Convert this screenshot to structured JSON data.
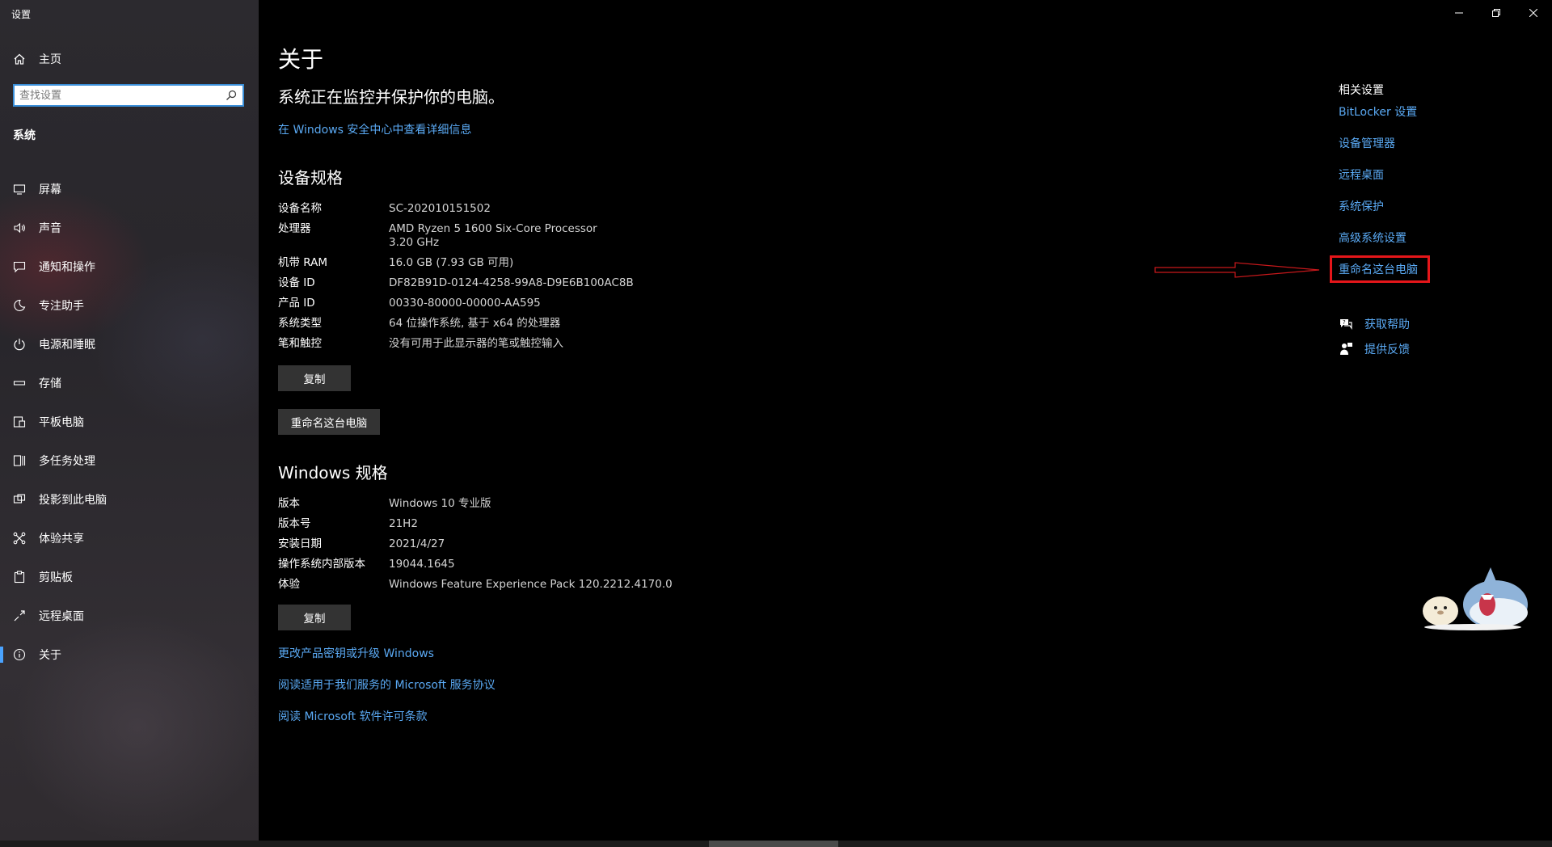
{
  "app": {
    "title": "设置"
  },
  "sidebar": {
    "home_label": "主页",
    "search_placeholder": "查找设置",
    "section_label": "系统",
    "items": [
      {
        "label": "屏幕",
        "icon": "monitor-icon"
      },
      {
        "label": "声音",
        "icon": "speaker-icon"
      },
      {
        "label": "通知和操作",
        "icon": "message-icon"
      },
      {
        "label": "专注助手",
        "icon": "moon-icon"
      },
      {
        "label": "电源和睡眠",
        "icon": "power-icon"
      },
      {
        "label": "存储",
        "icon": "storage-icon"
      },
      {
        "label": "平板电脑",
        "icon": "tablet-icon"
      },
      {
        "label": "多任务处理",
        "icon": "multitask-icon"
      },
      {
        "label": "投影到此电脑",
        "icon": "project-icon"
      },
      {
        "label": "体验共享",
        "icon": "share-icon"
      },
      {
        "label": "剪贴板",
        "icon": "clipboard-icon"
      },
      {
        "label": "远程桌面",
        "icon": "remote-icon"
      },
      {
        "label": "关于",
        "icon": "info-icon",
        "selected": true
      }
    ]
  },
  "main": {
    "title": "关于",
    "status": "系统正在监控并保护你的电脑。",
    "security_link": "在 Windows 安全中心中查看详细信息",
    "device_heading": "设备规格",
    "device_specs": [
      {
        "k": "设备名称",
        "v": "SC-202010151502"
      },
      {
        "k": "处理器",
        "v": "AMD Ryzen 5 1600 Six-Core Processor\n3.20 GHz"
      },
      {
        "k": "机带 RAM",
        "v": "16.0 GB (7.93 GB 可用)"
      },
      {
        "k": "设备 ID",
        "v": "DF82B91D-0124-4258-99A8-D9E6B100AC8B"
      },
      {
        "k": "产品 ID",
        "v": "00330-80000-00000-AA595"
      },
      {
        "k": "系统类型",
        "v": "64 位操作系统, 基于 x64 的处理器"
      },
      {
        "k": "笔和触控",
        "v": "没有可用于此显示器的笔或触控输入"
      }
    ],
    "copy_button": "复制",
    "rename_button": "重命名这台电脑",
    "windows_heading": "Windows 规格",
    "windows_specs": [
      {
        "k": "版本",
        "v": "Windows 10 专业版"
      },
      {
        "k": "版本号",
        "v": "21H2"
      },
      {
        "k": "安装日期",
        "v": "2021/4/27"
      },
      {
        "k": "操作系统内部版本",
        "v": "19044.1645"
      },
      {
        "k": "体验",
        "v": "Windows Feature Experience Pack 120.2212.4170.0"
      }
    ],
    "copy_button_2": "复制",
    "links": [
      "更改产品密钥或升级 Windows",
      "阅读适用于我们服务的 Microsoft 服务协议",
      "阅读 Microsoft 软件许可条款"
    ]
  },
  "related": {
    "title": "相关设置",
    "links": [
      "BitLocker 设置",
      "设备管理器",
      "远程桌面",
      "系统保护",
      "高级系统设置",
      "重命名这台电脑"
    ],
    "help": "获取帮助",
    "feedback": "提供反馈"
  },
  "colors": {
    "accent": "#5aa9f3",
    "highlight": "#e5161a",
    "selection": "#4aa3ff"
  }
}
